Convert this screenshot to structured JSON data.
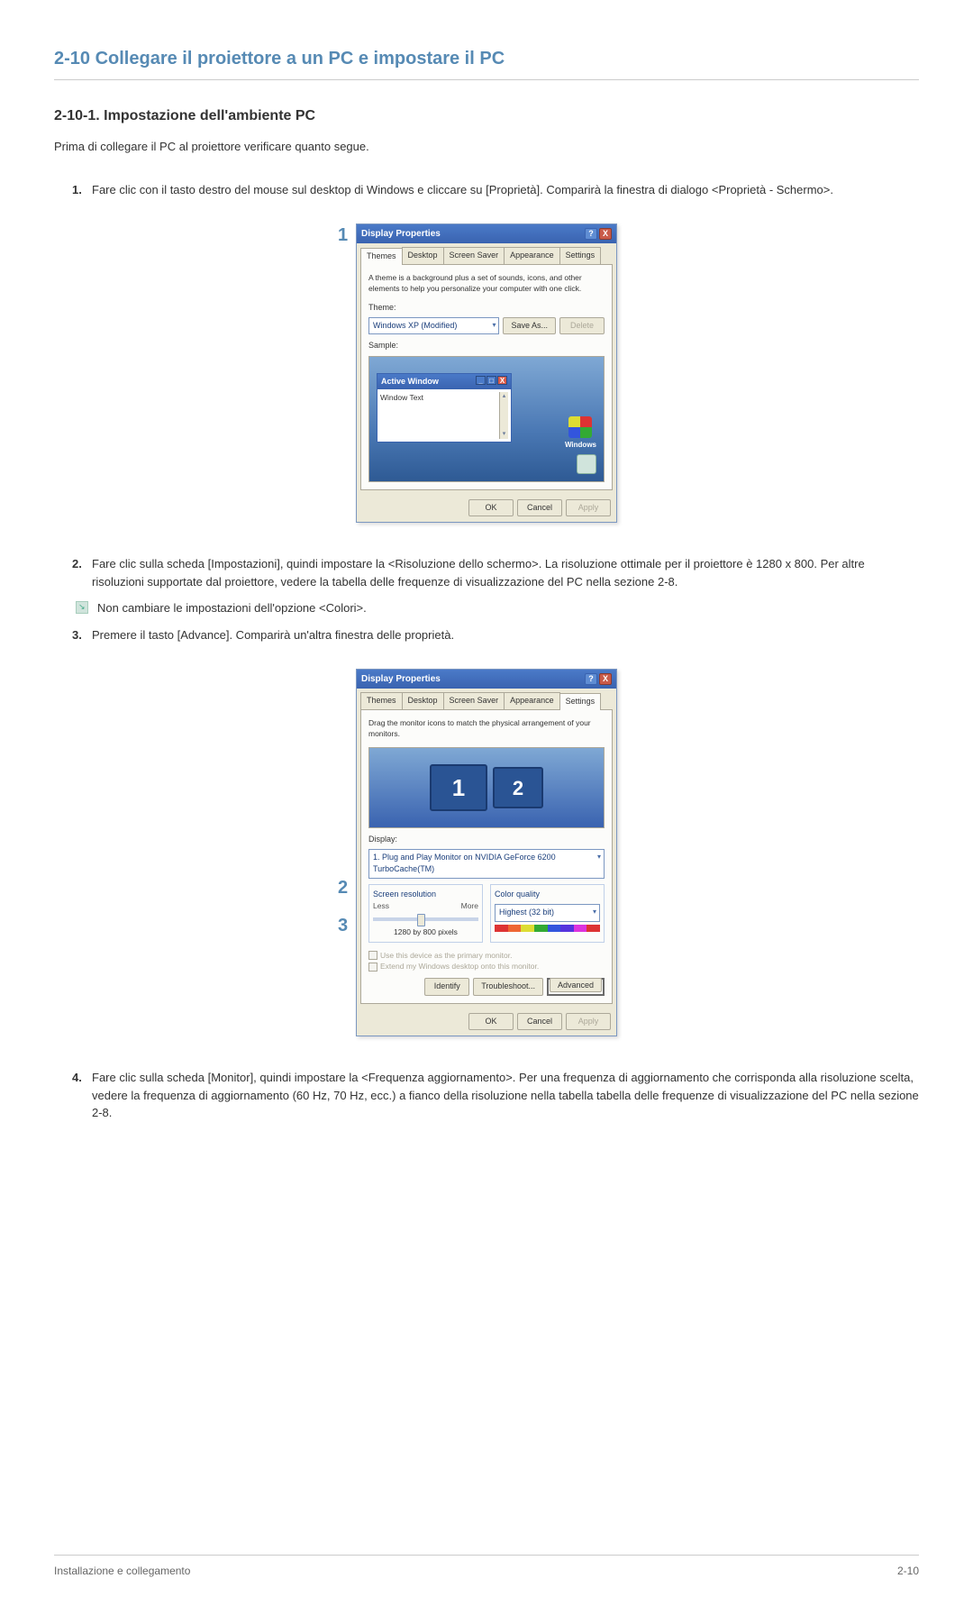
{
  "section_title": "2-10  Collegare il proiettore a un PC e impostare il PC",
  "subsection_title": "2-10-1. Impostazione dell'ambiente PC",
  "intro": "Prima di collegare il PC al proiettore verificare quanto segue.",
  "steps": {
    "s1": {
      "num": "1.",
      "text": "Fare clic con il tasto destro del mouse sul desktop di Windows e cliccare su [Proprietà]. Comparirà la finestra di dialogo <Proprietà - Schermo>."
    },
    "s2": {
      "num": "2.",
      "text": "Fare clic sulla scheda [Impostazioni], quindi impostare la <Risoluzione dello schermo>. La risoluzione ottimale per il proiettore è 1280 x 800. Per altre risoluzioni supportate dal proiettore, vedere la tabella delle frequenze di visualizzazione del PC nella sezione 2-8."
    },
    "s3": {
      "num": "3.",
      "text": "Premere il tasto [Advance]. Comparirà un'altra finestra delle proprietà."
    },
    "s4": {
      "num": "4.",
      "text": "Fare clic sulla scheda [Monitor], quindi impostare la <Frequenza aggiornamento>. Per una frequenza di aggiornamento che corrisponda alla risoluzione scelta, vedere la frequenza di aggiornamento (60 Hz, 70 Hz, ecc.) a fianco della risoluzione nella tabella tabella delle frequenze di visualizzazione del PC nella sezione 2-8."
    }
  },
  "note": "Non cambiare le impostazioni dell'opzione <Colori>.",
  "callouts": {
    "fig1": "1",
    "fig2_2": "2",
    "fig2_3": "3"
  },
  "dlg1": {
    "title": "Display Properties",
    "tabs": {
      "themes": "Themes",
      "desktop": "Desktop",
      "saver": "Screen Saver",
      "appearance": "Appearance",
      "settings": "Settings"
    },
    "desc": "A theme is a background plus a set of sounds, icons, and other elements to help you personalize your computer with one click.",
    "theme_label": "Theme:",
    "theme_value": "Windows XP (Modified)",
    "save_as": "Save As...",
    "delete": "Delete",
    "sample_label": "Sample:",
    "active_window": "Active Window",
    "window_text": "Window Text",
    "winlogo": "Windows",
    "ok": "OK",
    "cancel": "Cancel",
    "apply": "Apply",
    "help": "?",
    "close": "X"
  },
  "dlg2": {
    "title": "Display Properties",
    "tabs": {
      "themes": "Themes",
      "desktop": "Desktop",
      "saver": "Screen Saver",
      "appearance": "Appearance",
      "settings": "Settings"
    },
    "desc": "Drag the monitor icons to match the physical arrangement of your monitors.",
    "mon1": "1",
    "mon2": "2",
    "display_label": "Display:",
    "display_value": "1. Plug and Play Monitor on NVIDIA GeForce 6200 TurboCache(TM)",
    "res_label": "Screen resolution",
    "less": "Less",
    "more": "More",
    "res_value": "1280 by 800  pixels",
    "cq_label": "Color quality",
    "cq_value": "Highest (32 bit)",
    "opt1": "Use this device as the primary monitor.",
    "opt2": "Extend my Windows desktop onto this monitor.",
    "identify": "Identify",
    "troubleshoot": "Troubleshoot...",
    "advanced": "Advanced",
    "ok": "OK",
    "cancel": "Cancel",
    "apply": "Apply",
    "help": "?",
    "close": "X"
  },
  "footer": {
    "left": "Installazione e collegamento",
    "right": "2-10"
  }
}
